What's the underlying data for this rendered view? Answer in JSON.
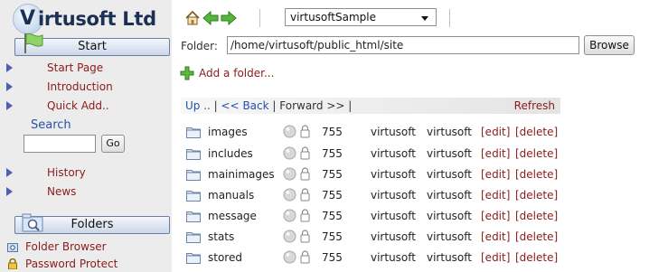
{
  "app": {
    "logo_v": "V",
    "logo_rest": "irtusoft Ltd"
  },
  "sidebar": {
    "start_label": "Start",
    "links": [
      {
        "label": "Start Page",
        "icon": "triangle-bullet-icon"
      },
      {
        "label": "Introduction",
        "icon": "triangle-bullet-icon"
      },
      {
        "label": "Quick Add..",
        "icon": "triangle-bullet-icon"
      }
    ],
    "search": {
      "title": "Search",
      "value": "",
      "placeholder": "",
      "go_label": "Go"
    },
    "links2": [
      {
        "label": "History",
        "icon": "triangle-bullet-icon"
      },
      {
        "label": "News",
        "icon": "triangle-bullet-icon"
      }
    ],
    "folders_label": "Folders",
    "tools": [
      {
        "label": "Folder Browser",
        "icon": "folder-browser-icon"
      },
      {
        "label": "Password Protect",
        "icon": "padlock-icon"
      }
    ]
  },
  "toolbar": {
    "icons": [
      "home-icon",
      "back-arrow-icon",
      "forward-arrow-icon"
    ],
    "site_select": {
      "value": "virtusoftSample"
    }
  },
  "folder_bar": {
    "label": "Folder:",
    "path": "/home/virtusoft/public_html/site",
    "browse_label": "Browse"
  },
  "add_folder_label": "Add a folder...",
  "nav": {
    "up": "Up ..",
    "sep1": " | ",
    "back": "<< Back",
    "sep2": " | ",
    "forward": "Forward >>",
    "sep3": " |",
    "refresh": "Refresh"
  },
  "table": {
    "edit_label": "[edit]",
    "delete_label": "[delete]",
    "rows": [
      {
        "name": "images",
        "perm": "755",
        "owner": "virtusoft",
        "group": "virtusoft"
      },
      {
        "name": "includes",
        "perm": "755",
        "owner": "virtusoft",
        "group": "virtusoft"
      },
      {
        "name": "mainimages",
        "perm": "755",
        "owner": "virtusoft",
        "group": "virtusoft"
      },
      {
        "name": "manuals",
        "perm": "755",
        "owner": "virtusoft",
        "group": "virtusoft"
      },
      {
        "name": "message",
        "perm": "755",
        "owner": "virtusoft",
        "group": "virtusoft"
      },
      {
        "name": "stats",
        "perm": "755",
        "owner": "virtusoft",
        "group": "virtusoft"
      },
      {
        "name": "stored",
        "perm": "755",
        "owner": "virtusoft",
        "group": "virtusoft"
      }
    ]
  },
  "colors": {
    "link": "#8a1b1b",
    "nav_link": "#2452a8",
    "sidebar_bg": "#ececec",
    "bullet": "#4b5fb3"
  }
}
